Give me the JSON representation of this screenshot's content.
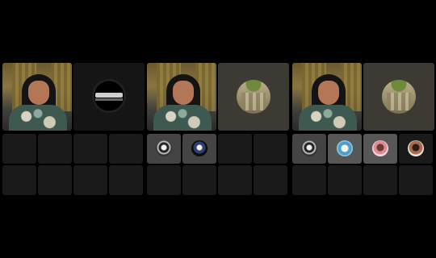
{
  "panels": [
    {
      "id": "panel-1",
      "speaker": {
        "video": "speaker-video",
        "background": "curtains"
      },
      "secondary": {
        "kind": "camera-off-icon"
      },
      "grid_rows": [
        [
          "empty",
          "empty",
          "empty",
          "empty"
        ],
        [
          "empty",
          "empty",
          "empty",
          "empty"
        ]
      ]
    },
    {
      "id": "panel-2",
      "speaker": {
        "video": "speaker-video",
        "background": "curtains"
      },
      "secondary": {
        "kind": "group-avatar"
      },
      "grid_rows": [
        [
          "participant-bw",
          "participant-blue",
          "empty",
          "empty"
        ],
        [
          "empty",
          "empty",
          "empty",
          "empty"
        ]
      ]
    },
    {
      "id": "panel-3",
      "speaker": {
        "video": "speaker-video",
        "background": "curtains"
      },
      "secondary": {
        "kind": "group-avatar"
      },
      "grid_rows": [
        [
          "participant-bw",
          "participant-lightblue",
          "participant-pink",
          "participant-dark"
        ],
        [
          "empty",
          "empty",
          "empty",
          "empty"
        ]
      ]
    }
  ],
  "colors": {
    "background": "#000000",
    "tile_empty": "#1a1a1a",
    "tile_active": "#444444",
    "tile_active_light": "#575757"
  }
}
